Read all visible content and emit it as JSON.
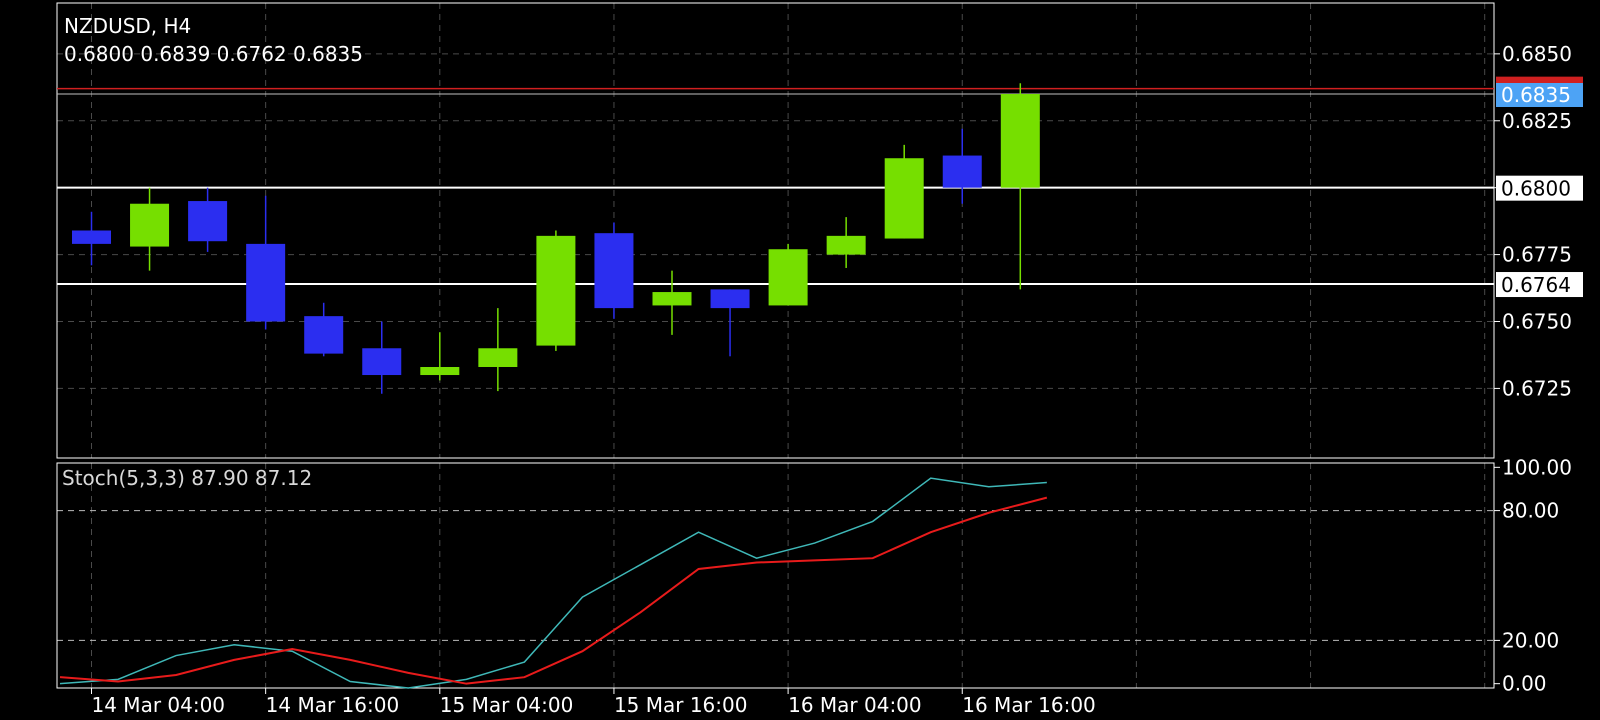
{
  "header": {
    "symbol_tf": "NZDUSD, H4",
    "ohlc": "0.6800 0.6839 0.6762 0.6835"
  },
  "indicator": {
    "label": "Stoch(5,3,3) 87.90 87.12"
  },
  "colors": {
    "bull": "#76df00",
    "bear": "#2b2ef0",
    "grid": "#4a4a4a",
    "frame": "#ffffff",
    "k_line": "#3fb8b8",
    "d_line": "#e81b1b",
    "ask_line": "#d02020",
    "bid_tag": "#4da3f5"
  },
  "chart_data": [
    {
      "type": "candlestick",
      "title": "NZDUSD, H4",
      "ylim": [
        0.6699,
        0.6869
      ],
      "y_ticks": [
        0.6725,
        0.675,
        0.6775,
        0.68,
        0.6825,
        0.685
      ],
      "y_tick_labels": [
        "0.6725",
        "0.6750",
        "0.6775",
        "0.6800",
        "0.6825",
        "0.6850"
      ],
      "x_tick_labels": [
        "14 Mar 04:00",
        "14 Mar 16:00",
        "15 Mar 04:00",
        "15 Mar 16:00",
        "16 Mar 04:00",
        "16 Mar 16:00"
      ],
      "candles": [
        {
          "open": 0.6784,
          "high": 0.6791,
          "low": 0.6771,
          "close": 0.6779
        },
        {
          "open": 0.6778,
          "high": 0.68,
          "low": 0.6769,
          "close": 0.6794
        },
        {
          "open": 0.6795,
          "high": 0.68,
          "low": 0.6776,
          "close": 0.678
        },
        {
          "open": 0.6779,
          "high": 0.6797,
          "low": 0.6747,
          "close": 0.675
        },
        {
          "open": 0.6752,
          "high": 0.6757,
          "low": 0.6737,
          "close": 0.6738
        },
        {
          "open": 0.674,
          "high": 0.675,
          "low": 0.6723,
          "close": 0.673
        },
        {
          "open": 0.673,
          "high": 0.6746,
          "low": 0.6728,
          "close": 0.6733
        },
        {
          "open": 0.6733,
          "high": 0.6755,
          "low": 0.6724,
          "close": 0.674
        },
        {
          "open": 0.6741,
          "high": 0.6784,
          "low": 0.6739,
          "close": 0.6782
        },
        {
          "open": 0.6783,
          "high": 0.6787,
          "low": 0.6751,
          "close": 0.6755
        },
        {
          "open": 0.6756,
          "high": 0.6769,
          "low": 0.6745,
          "close": 0.6761
        },
        {
          "open": 0.6762,
          "high": 0.6762,
          "low": 0.6737,
          "close": 0.6755
        },
        {
          "open": 0.6756,
          "high": 0.6779,
          "low": 0.6756,
          "close": 0.6777
        },
        {
          "open": 0.6775,
          "high": 0.6789,
          "low": 0.677,
          "close": 0.6782
        },
        {
          "open": 0.6781,
          "high": 0.6816,
          "low": 0.6781,
          "close": 0.6811
        },
        {
          "open": 0.6812,
          "high": 0.6822,
          "low": 0.6794,
          "close": 0.68
        },
        {
          "open": 0.68,
          "high": 0.6839,
          "low": 0.6762,
          "close": 0.6835
        }
      ],
      "horizontal_lines": [
        {
          "value": 0.68,
          "label": "0.6800"
        },
        {
          "value": 0.6764,
          "label": "0.6764"
        }
      ],
      "bid": {
        "value": 0.6835,
        "label": "0.6835"
      },
      "ask": {
        "value": 0.6837
      }
    },
    {
      "type": "line",
      "title": "Stoch(5,3,3) 87.90 87.12",
      "ylim": [
        -2,
        102
      ],
      "y_ticks": [
        0,
        20,
        80,
        100
      ],
      "y_tick_labels": [
        "0.00",
        "20.00",
        "80.00",
        "100.00"
      ],
      "levels": [
        20,
        80
      ],
      "series": [
        {
          "values": [
            0,
            2,
            13,
            18,
            15,
            1,
            -2,
            2,
            10,
            40,
            55,
            70,
            58,
            65,
            75,
            95,
            91,
            93
          ]
        },
        {
          "values": [
            3,
            1,
            4,
            11,
            16,
            11,
            5,
            0,
            3,
            15,
            33,
            53,
            56,
            57,
            58,
            70,
            79,
            86
          ]
        }
      ]
    }
  ]
}
